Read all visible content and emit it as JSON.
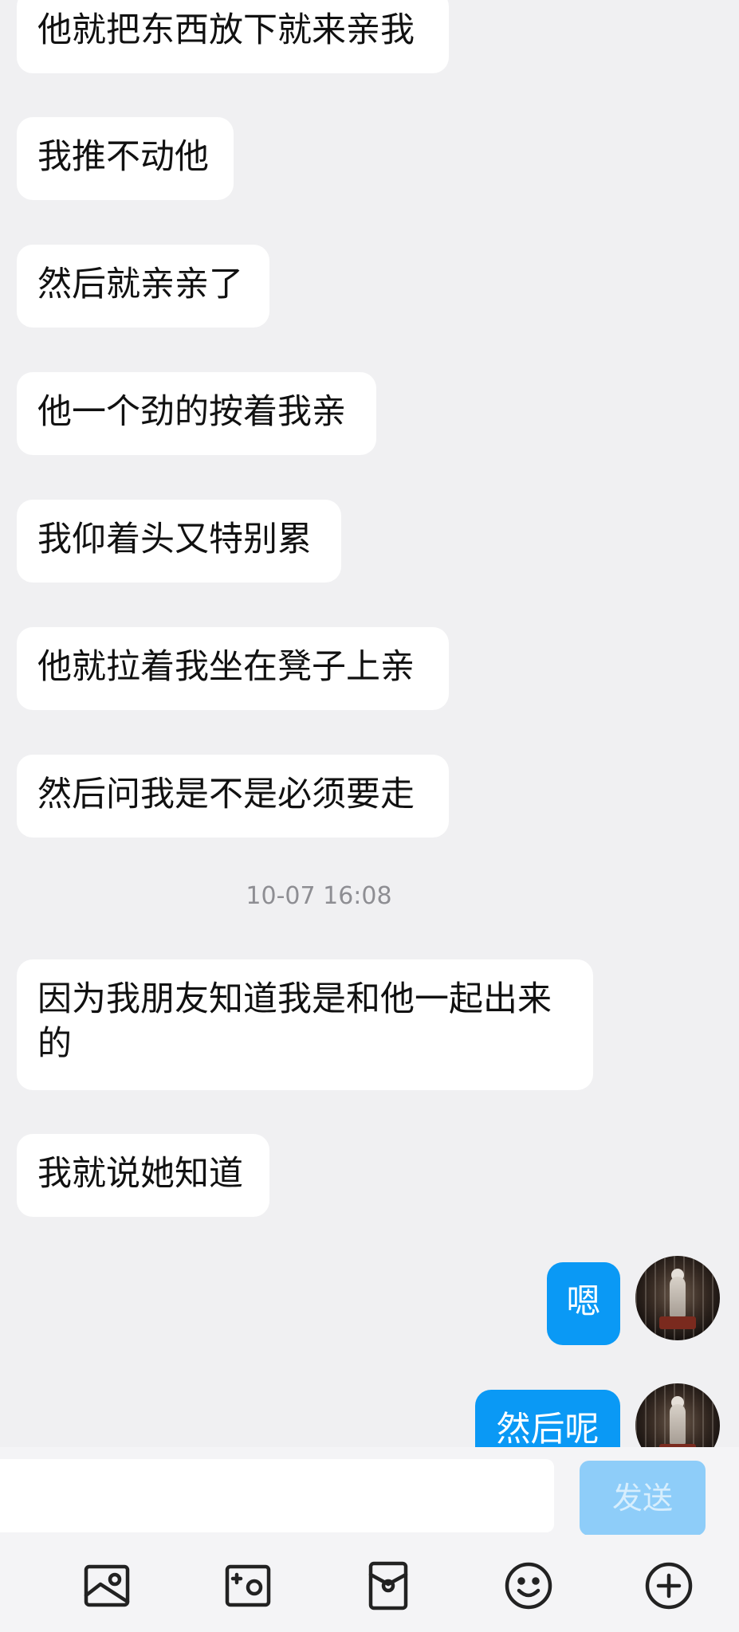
{
  "messages": [
    {
      "dir": "in",
      "text": "他就把东西放下就来亲我"
    },
    {
      "dir": "in",
      "text": "我推不动他"
    },
    {
      "dir": "in",
      "text": "然后就亲亲了"
    },
    {
      "dir": "in",
      "text": "他一个劲的按着我亲"
    },
    {
      "dir": "in",
      "text": "我仰着头又特别累"
    },
    {
      "dir": "in",
      "text": "他就拉着我坐在凳子上亲"
    },
    {
      "dir": "in",
      "text": "然后问我是不是必须要走"
    },
    {
      "dir": "in",
      "text": "因为我朋友知道我是和他一起出来的"
    },
    {
      "dir": "in",
      "text": "我就说她知道"
    },
    {
      "dir": "out",
      "text": "嗯"
    },
    {
      "dir": "out",
      "text": "然后呢"
    }
  ],
  "timestamp": "10-07 16:08",
  "composer": {
    "input_value": "",
    "send_label": "发送"
  },
  "toolbar": {
    "items": [
      "image-icon",
      "camera-icon",
      "red-packet-icon",
      "emoji-icon",
      "plus-icon"
    ]
  },
  "colors": {
    "background": "#f0f0f2",
    "incoming_bubble": "#ffffff",
    "outgoing_bubble": "#0a99f5",
    "send_button_disabled": "#8ecdf9",
    "timestamp_text": "#8e8e93"
  }
}
